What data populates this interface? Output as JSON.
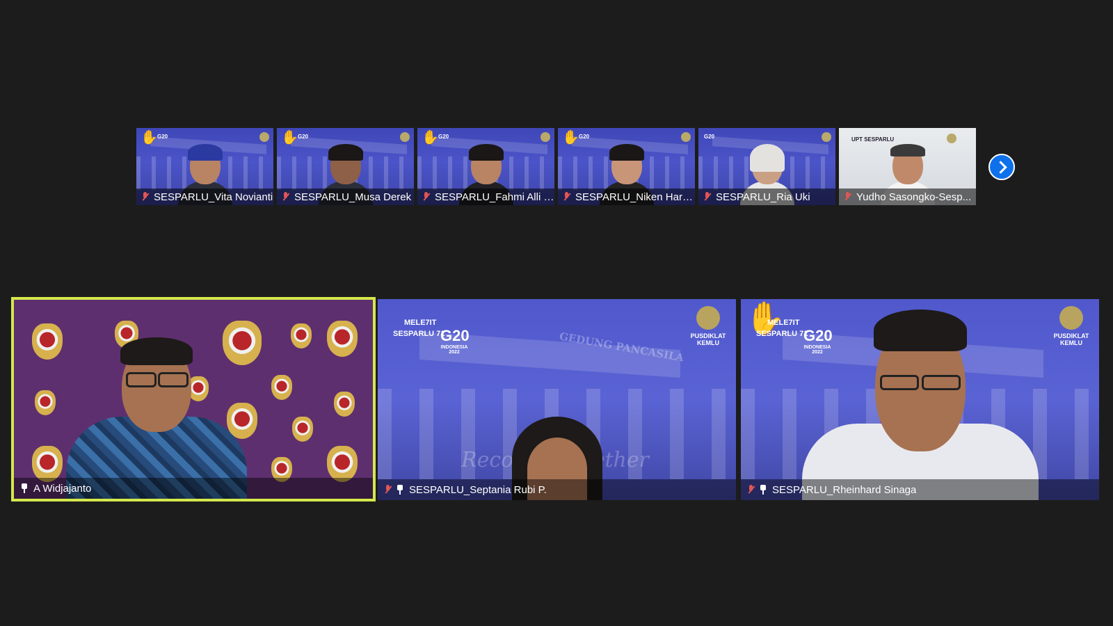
{
  "thumbnails": [
    {
      "name": "SESPARLU_Vita Novianti",
      "hand_raised": true,
      "muted": true
    },
    {
      "name": "SESPARLU_Musa Derek",
      "hand_raised": true,
      "muted": true
    },
    {
      "name": "SESPARLU_Fahmi Alli S...",
      "hand_raised": true,
      "muted": true
    },
    {
      "name": "SESPARLU_Niken Hard...",
      "hand_raised": true,
      "muted": true
    },
    {
      "name": "SESPARLU_Ria Uki",
      "hand_raised": false,
      "muted": true
    },
    {
      "name": "Yudho Sasongko-Sesp...",
      "hand_raised": false,
      "muted": true
    }
  ],
  "thumb_logos": {
    "g20": "G20",
    "upt": "UPT SESPARLU",
    "pusdiklat": "PUSDIKLAT KEMLU RI"
  },
  "next_button_icon": "chevron-right-icon",
  "main": [
    {
      "name": "A Widjajanto",
      "active_speaker": true,
      "muted": false
    },
    {
      "name": "SESPARLU_Septania Rubi P.",
      "muted": true
    },
    {
      "name": "SESPARLU_Rheinhard Sinaga",
      "muted": true,
      "hand_raised": true
    }
  ],
  "branding": {
    "mele7it": "MELE7IT",
    "sesparlu71": "SESPARLU 71",
    "g20": "G20",
    "indonesia": "INDONESIA 2022",
    "pusdiklat": "PUSDIKLAT KEMLU",
    "building": "GEDUNG PANCASILA",
    "tagline": "Recover Together"
  },
  "colors": {
    "active_border": "#d4e84b",
    "next_button": "#0e71eb",
    "muted_mic": "#e25555",
    "background": "#1c1c1c"
  }
}
